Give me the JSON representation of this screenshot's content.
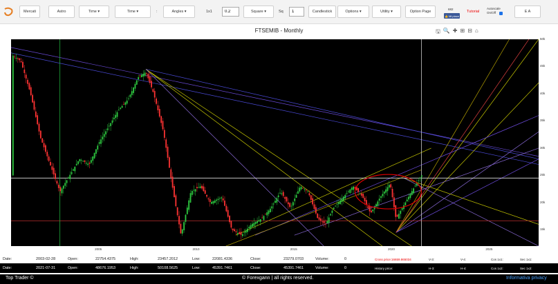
{
  "toolbar": {
    "mercati": "Mercati",
    "astro": "Astro",
    "time1": "Time ▾",
    "time2": "Time ▾",
    "colon": ":",
    "angles": "Angles ▾",
    "ratio_label": "1x1",
    "ratio_value": "0.2",
    "square": "Square ▾",
    "sq_label": "Sq",
    "sq_value": "1",
    "candlestick": "Candlestick",
    "options": "Options ▾",
    "utility": "Utility ▾",
    "option_page": "Option Page",
    "likes": "682",
    "fb": "👍 Mi piace",
    "tutorial": "Tutorial",
    "autoscale": "Autoscale On/Off",
    "ea": "E A"
  },
  "chart_title": "FTSEMIB - Monthly",
  "yticks": [
    "50k",
    "45k",
    "40k",
    "35k",
    "30k",
    "25k",
    "20k",
    "15k"
  ],
  "xticks": [
    "2005",
    "2010",
    "2015",
    "2020",
    "2025"
  ],
  "row1": {
    "date_l": "Date:",
    "date": "2003-02-28",
    "open_l": "Open:",
    "open": "22754.4375",
    "high_l": "High:",
    "high": "23457.2012",
    "low_l": "Low:",
    "low": "22081.4336",
    "close_l": "Close:",
    "close": "23279.0703",
    "vol_l": "Volume:",
    "vol": "0",
    "cross": "Cross price:16659.865034",
    "v1": "V-3:",
    "v2": "V-4:",
    "v3": "Cos 1x1:",
    "v4": "Sec 1x1:"
  },
  "row2": {
    "date_l": "Date:",
    "date": "2021-07-31",
    "open_l": "Open:",
    "open": "48676.1953",
    "high_l": "High:",
    "high": "50108.5625",
    "low_l": "Low:",
    "low": "45391.7461",
    "close_l": "Close:",
    "close": "45391.7461",
    "vol_l": "Volume:",
    "vol": "0",
    "hist": "History price:",
    "v1": "H-3:",
    "v2": "H-4:",
    "v3": "Cos 1x2:",
    "v4": "Sec 1x2:"
  },
  "footer": {
    "left": "Top Trader ©",
    "center": "© Forexgann | all rights reserved.",
    "right": "Informativa privacy"
  },
  "chart_data": {
    "type": "candlestick",
    "title": "FTSEMIB - Monthly",
    "ylim": [
      12000,
      50000
    ],
    "xlim": [
      2000.5,
      2027.5
    ],
    "approx_close": [
      [
        2000.6,
        47000
      ],
      [
        2001.0,
        46000
      ],
      [
        2001.5,
        40000
      ],
      [
        2002.0,
        32000
      ],
      [
        2002.5,
        27000
      ],
      [
        2003.0,
        22000
      ],
      [
        2003.5,
        25000
      ],
      [
        2004.0,
        28000
      ],
      [
        2004.5,
        27000
      ],
      [
        2005.0,
        31000
      ],
      [
        2005.5,
        34000
      ],
      [
        2006.0,
        37000
      ],
      [
        2006.5,
        39000
      ],
      [
        2007.0,
        43000
      ],
      [
        2007.4,
        44000
      ],
      [
        2007.8,
        40000
      ],
      [
        2008.3,
        33000
      ],
      [
        2008.8,
        22000
      ],
      [
        2009.2,
        14000
      ],
      [
        2009.7,
        22000
      ],
      [
        2010.2,
        23000
      ],
      [
        2010.7,
        20000
      ],
      [
        2011.3,
        21000
      ],
      [
        2011.8,
        15000
      ],
      [
        2012.3,
        14000
      ],
      [
        2012.8,
        16000
      ],
      [
        2013.3,
        17000
      ],
      [
        2013.8,
        19000
      ],
      [
        2014.3,
        22000
      ],
      [
        2014.8,
        19000
      ],
      [
        2015.3,
        23000
      ],
      [
        2015.7,
        22000
      ],
      [
        2016.2,
        17000
      ],
      [
        2016.6,
        16000
      ],
      [
        2017.0,
        19000
      ],
      [
        2017.5,
        21000
      ],
      [
        2018.0,
        23000
      ],
      [
        2018.5,
        21000
      ],
      [
        2018.9,
        18000
      ],
      [
        2019.4,
        21000
      ],
      [
        2019.9,
        23500
      ],
      [
        2020.2,
        17000
      ],
      [
        2020.6,
        19500
      ],
      [
        2021.0,
        22000
      ],
      [
        2021.5,
        25000
      ]
    ]
  },
  "colors": {
    "chart_bg": "#000000",
    "candle_up": "#2ecc40",
    "candle_down": "#ff3333",
    "ellipse": "#e00000"
  }
}
